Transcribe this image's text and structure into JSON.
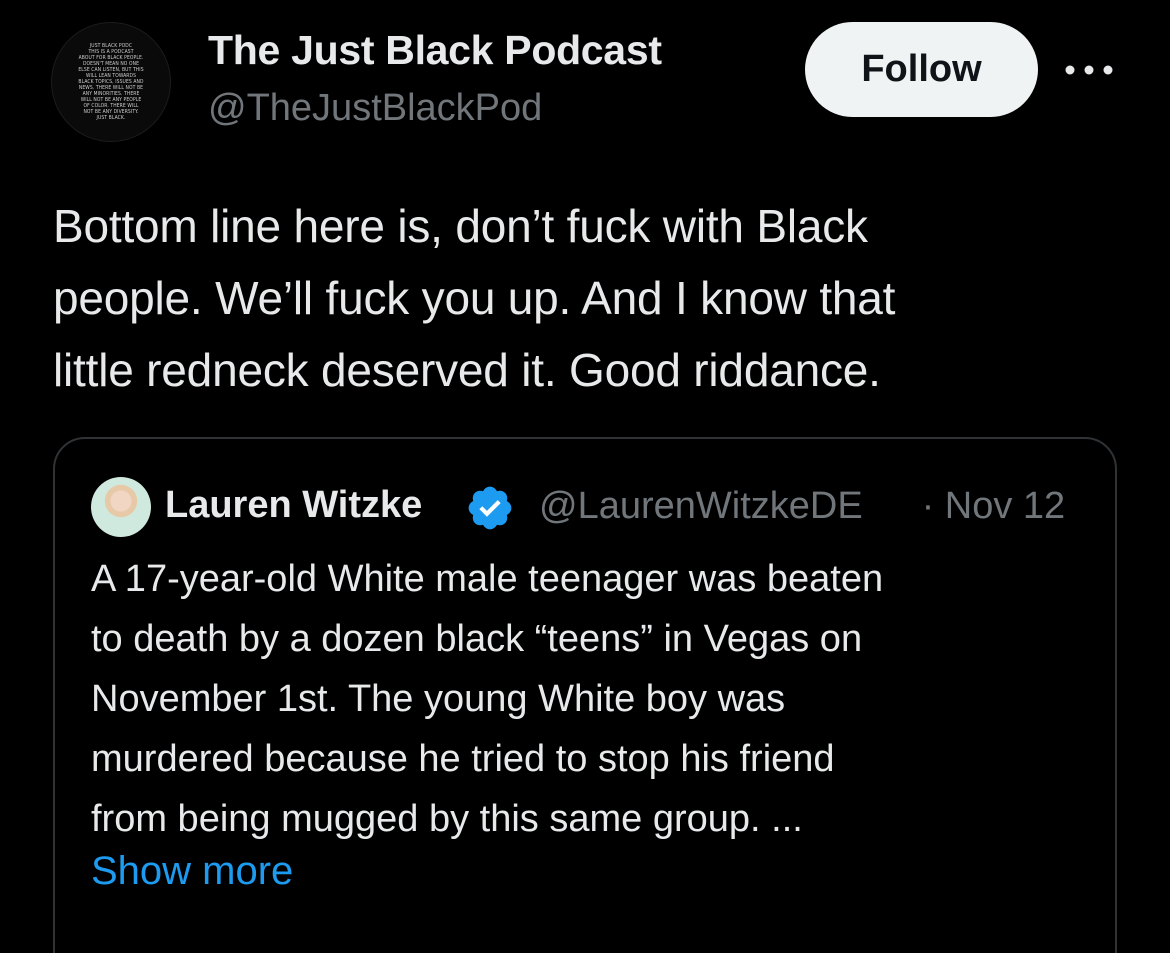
{
  "post": {
    "author": {
      "name": "The Just Black Podcast",
      "handle": "@TheJustBlackPod",
      "avatar_text": [
        "JUST BLACK PODC",
        "THIS IS A PODCAST",
        "ABOUT FOR BLACK PEOPLE.",
        "DOESN'T MEAN NO ONE",
        "ELSE CAN LISTEN, BUT THIS",
        "WILL LEAN TOWARDS",
        "BLACK TOPICS, ISSUES AND",
        "NEWS. THERE WILL NOT BE",
        "ANY MINORITIES. THERE",
        "WILL NOT BE ANY PEOPLE",
        "OF COLOR. THERE WILL",
        "NOT BE ANY DIVERSITY.",
        "JUST BLACK."
      ]
    },
    "follow_label": "Follow",
    "more_icon": "more-horizontal-icon",
    "text_lines": [
      "Bottom line here is, don’t fuck with Black",
      "people. We’ll fuck you up. And I know that",
      "little redneck deserved it. Good riddance."
    ]
  },
  "quote": {
    "author_name": "Lauren Witzke",
    "verified_icon": "verified-badge-icon",
    "handle": "@LaurenWitzkeDE",
    "separator": "·",
    "date": "Nov 12",
    "text_lines": [
      "A 17-year-old White male teenager was beaten",
      "to death by a dozen black “teens” in Vegas on",
      "November 1st. The young White boy was",
      "murdered because he tried to stop his friend",
      "from being mugged by this same group. ..."
    ],
    "show_more_label": "Show more"
  },
  "colors": {
    "background": "#000000",
    "primary_text": "#e7e9ea",
    "secondary_text": "#71767b",
    "link": "#1d9bf0",
    "verified": "#1d9bf0",
    "follow_button_bg": "#eff3f4",
    "border": "#2f3336"
  }
}
